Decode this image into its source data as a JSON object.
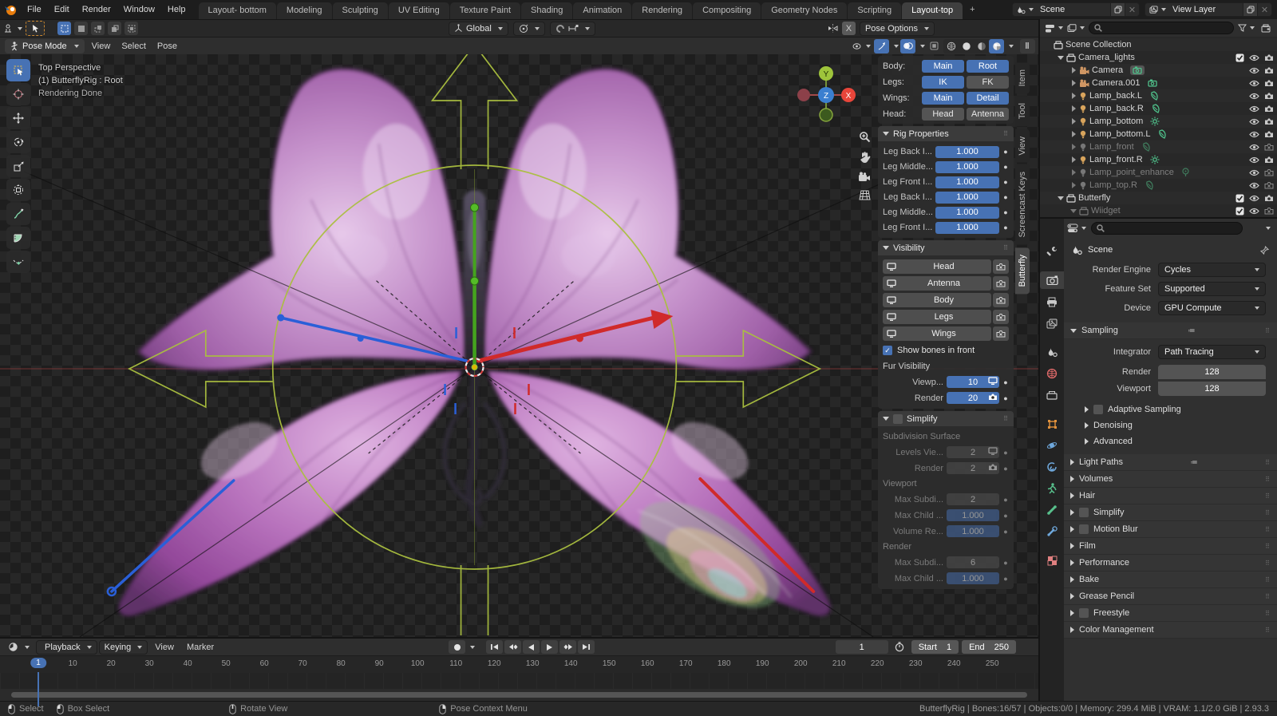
{
  "topbar": {
    "menus": [
      "File",
      "Edit",
      "Render",
      "Window",
      "Help"
    ],
    "workspaces": [
      "Layout- bottom",
      "Modeling",
      "Sculpting",
      "UV Editing",
      "Texture Paint",
      "Shading",
      "Animation",
      "Rendering",
      "Compositing",
      "Geometry Nodes",
      "Scripting",
      "Layout-top"
    ],
    "active_workspace": "Layout-top",
    "add_workspace": "+",
    "scene_name": "Scene",
    "view_layer_name": "View Layer"
  },
  "tool_settings": {
    "orientation": "Global",
    "mirror_x": "X",
    "pose_options": "Pose Options"
  },
  "viewport": {
    "mode": "Pose Mode",
    "menus": [
      "View",
      "Select",
      "Pose"
    ],
    "overlay_text": [
      "Top Perspective",
      "(1) ButterflyRig : Root",
      "Rendering Done"
    ],
    "axis_labels": {
      "x": "X",
      "y": "Y",
      "z": "Z"
    },
    "colors": {
      "rig_green": "#aabf3f",
      "bone_blue": "#2a5fd8",
      "bone_red": "#d02a2a",
      "bone_green": "#45a31e",
      "axis_x": "#e8403a",
      "axis_y": "#9ec43b",
      "axis_z": "#3b7fd0"
    }
  },
  "sidebar": {
    "tabs": [
      {
        "label": "Item",
        "active": false
      },
      {
        "label": "Tool",
        "active": false
      },
      {
        "label": "View",
        "active": false
      },
      {
        "label": "Screencast Keys",
        "active": false
      },
      {
        "label": "Butterfly",
        "active": true
      }
    ],
    "mirror_rows": [
      {
        "label": "Body:",
        "buttons": [
          {
            "label": "Main",
            "on": true
          },
          {
            "label": "Root",
            "on": true
          }
        ]
      },
      {
        "label": "Legs:",
        "buttons": [
          {
            "label": "IK",
            "on": true
          },
          {
            "label": "FK",
            "on": false
          }
        ]
      },
      {
        "label": "Wings:",
        "buttons": [
          {
            "label": "Main",
            "on": true
          },
          {
            "label": "Detail",
            "on": true
          }
        ]
      },
      {
        "label": "Head:",
        "buttons": [
          {
            "label": "Head",
            "on": false
          },
          {
            "label": "Antenna",
            "on": false
          }
        ]
      }
    ],
    "rig_properties": {
      "title": "Rig Properties",
      "sliders": [
        {
          "label": "Leg Back I...",
          "value": "1.000"
        },
        {
          "label": "Leg Middle...",
          "value": "1.000"
        },
        {
          "label": "Leg Front I...",
          "value": "1.000"
        },
        {
          "label": "Leg Back I...",
          "value": "1.000"
        },
        {
          "label": "Leg Middle...",
          "value": "1.000"
        },
        {
          "label": "Leg Front I...",
          "value": "1.000"
        }
      ]
    },
    "visibility": {
      "title": "Visibility",
      "layers": [
        "Head",
        "Antenna",
        "Body",
        "Legs",
        "Wings"
      ],
      "show_bones": {
        "label": "Show bones in front",
        "checked": true
      },
      "fur_title": "Fur Visibility",
      "fields": [
        {
          "label": "Viewp...",
          "value": "10",
          "icon": "monitor"
        },
        {
          "label": "Render",
          "value": "20",
          "icon": "camera"
        }
      ]
    },
    "simplify": {
      "title": "Simplify",
      "checked": false,
      "groups": [
        {
          "heading": "Subdivision Surface",
          "fields": [
            {
              "label": "Levels Vie...",
              "value": "2",
              "icon": "monitor",
              "blue": false
            },
            {
              "label": "Render",
              "value": "2",
              "icon": "camera",
              "blue": false
            }
          ]
        },
        {
          "heading": "Viewport",
          "fields": [
            {
              "label": "Max Subdi...",
              "value": "2",
              "blue": false
            },
            {
              "label": "Max Child ...",
              "value": "1.000",
              "blue": true
            },
            {
              "label": "Volume Re...",
              "value": "1.000",
              "blue": true
            }
          ]
        },
        {
          "heading": "Render",
          "fields": [
            {
              "label": "Max Subdi...",
              "value": "6",
              "blue": false
            },
            {
              "label": "Max Child ...",
              "value": "1.000",
              "blue": true
            }
          ]
        }
      ]
    }
  },
  "outliner": {
    "rows": [
      {
        "name": "Scene Collection",
        "icon": "collection",
        "depth": 0,
        "disclosure": "none",
        "right": []
      },
      {
        "name": "Camera_lights",
        "icon": "collection",
        "depth": 1,
        "disclosure": "open",
        "right": [
          "checkbox",
          "eye",
          "camera"
        ]
      },
      {
        "name": "Camera",
        "icon": "camera-obj",
        "badge": "camera-data",
        "badge_selected": true,
        "depth": 2,
        "disclosure": "closed",
        "right": [
          "eye",
          "camera"
        ]
      },
      {
        "name": "Camera.001",
        "icon": "camera-obj",
        "badge": "camera-data",
        "depth": 2,
        "disclosure": "closed",
        "right": [
          "eye",
          "camera"
        ]
      },
      {
        "name": "Lamp_back.L",
        "icon": "light",
        "badge": "light-area",
        "depth": 2,
        "disclosure": "closed",
        "right": [
          "eye",
          "camera"
        ]
      },
      {
        "name": "Lamp_back.R",
        "icon": "light",
        "badge": "light-area",
        "depth": 2,
        "disclosure": "closed",
        "right": [
          "eye",
          "camera"
        ]
      },
      {
        "name": "Lamp_bottom",
        "icon": "light",
        "badge": "light-sun",
        "depth": 2,
        "disclosure": "closed",
        "right": [
          "eye",
          "camera"
        ]
      },
      {
        "name": "Lamp_bottom.L",
        "icon": "light",
        "badge": "light-area",
        "depth": 2,
        "disclosure": "closed",
        "right": [
          "eye",
          "camera"
        ]
      },
      {
        "name": "Lamp_front",
        "icon": "light",
        "badge": "light-area",
        "depth": 2,
        "disclosure": "closed",
        "dim": true,
        "right": [
          "eye",
          "camera-off"
        ]
      },
      {
        "name": "Lamp_front.R",
        "icon": "light",
        "badge": "light-sun",
        "depth": 2,
        "disclosure": "closed",
        "right": [
          "eye",
          "camera"
        ]
      },
      {
        "name": "Lamp_point_enhance",
        "icon": "light",
        "badge": "light-point",
        "depth": 2,
        "disclosure": "closed",
        "dim": true,
        "right": [
          "eye",
          "camera-off"
        ]
      },
      {
        "name": "Lamp_top.R",
        "icon": "light",
        "badge": "light-area",
        "depth": 2,
        "disclosure": "closed",
        "dim": true,
        "right": [
          "eye",
          "camera-off"
        ]
      },
      {
        "name": "Butterfly",
        "icon": "collection",
        "depth": 1,
        "disclosure": "open",
        "right": [
          "checkbox",
          "eye",
          "camera"
        ]
      },
      {
        "name": "Wiidget",
        "icon": "collection",
        "depth": 2,
        "disclosure": "open",
        "dim": true,
        "right": [
          "checkbox",
          "eye",
          "camera-off"
        ]
      }
    ]
  },
  "properties": {
    "breadcrumb": "Scene",
    "tabs": [
      "tool",
      "render",
      "output",
      "view-layer",
      "scene",
      "world",
      "collection",
      "object",
      "physics",
      "constraints",
      "data",
      "bone",
      "bone-constraint",
      "texture"
    ],
    "active_tab": "render",
    "fields": [
      {
        "label": "Render Engine",
        "value": "Cycles"
      },
      {
        "label": "Feature Set",
        "value": "Supported"
      },
      {
        "label": "Device",
        "value": "GPU Compute"
      }
    ],
    "sampling": {
      "title": "Sampling",
      "integrator_label": "Integrator",
      "integrator": "Path Tracing",
      "render_label": "Render",
      "render_value": "128",
      "viewport_label": "Viewport",
      "viewport_value": "128",
      "subsections": [
        {
          "label": "Adaptive Sampling",
          "checkbox": true
        },
        {
          "label": "Denoising",
          "checkbox": false
        },
        {
          "label": "Advanced",
          "checkbox": false
        }
      ]
    },
    "sections": [
      {
        "label": "Light Paths",
        "checkbox": false,
        "preset": true
      },
      {
        "label": "Volumes",
        "checkbox": false
      },
      {
        "label": "Hair",
        "checkbox": false
      },
      {
        "label": "Simplify",
        "checkbox": true
      },
      {
        "label": "Motion Blur",
        "checkbox": true
      },
      {
        "label": "Film",
        "checkbox": false
      },
      {
        "label": "Performance",
        "checkbox": false
      },
      {
        "label": "Bake",
        "checkbox": false
      },
      {
        "label": "Grease Pencil",
        "checkbox": false
      },
      {
        "label": "Freestyle",
        "checkbox": true
      },
      {
        "label": "Color Management",
        "checkbox": false
      }
    ]
  },
  "timeline": {
    "menus": [
      "Playback",
      "Keying",
      "View",
      "Marker"
    ],
    "current_frame": "1",
    "start_label": "Start",
    "start_value": "1",
    "end_label": "End",
    "end_value": "250",
    "ticks": [
      1,
      10,
      20,
      30,
      40,
      50,
      60,
      70,
      80,
      90,
      100,
      110,
      120,
      130,
      140,
      150,
      160,
      170,
      180,
      190,
      200,
      210,
      220,
      230,
      240,
      250
    ]
  },
  "statusbar": {
    "hints": [
      {
        "label": "Select",
        "mouse": "lmb"
      },
      {
        "label": "Box Select",
        "mouse": "lmb-drag"
      },
      {
        "label": "Rotate View",
        "mouse": "mmb"
      },
      {
        "label": "Pose Context Menu",
        "mouse": "rmb"
      }
    ],
    "stats": "ButterflyRig | Bones:16/57 | Objects:0/0 | Memory: 299.4 MiB | VRAM: 1.1/2.0 GiB | 2.93.3"
  }
}
